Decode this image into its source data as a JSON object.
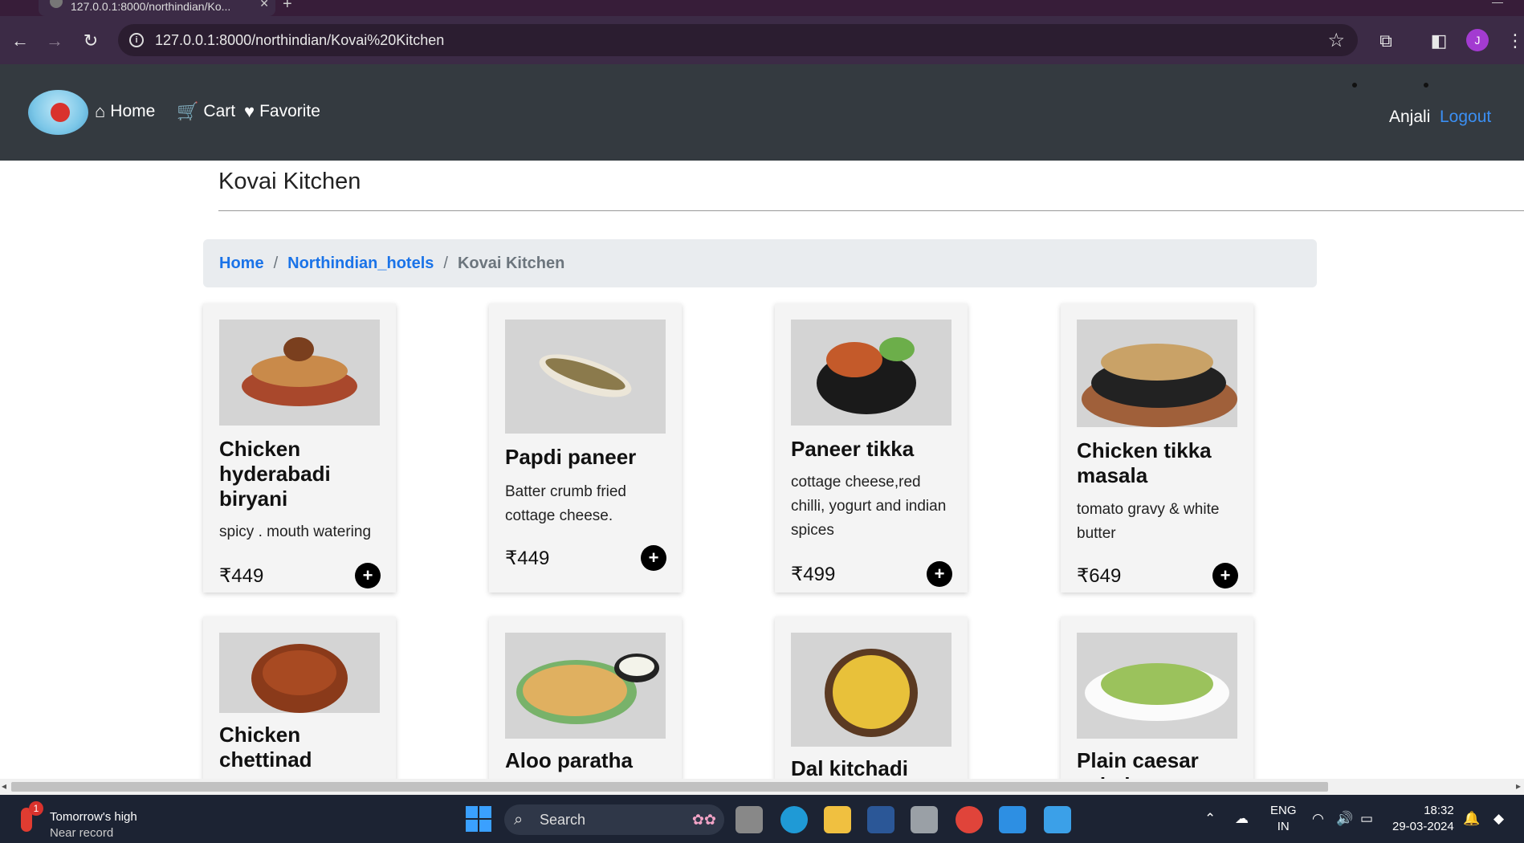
{
  "browser": {
    "tab_title": "127.0.0.1:8000/northindian/Ko...",
    "url": "127.0.0.1:8000/northindian/Kovai%20Kitchen",
    "profile_initial": "J"
  },
  "navbar": {
    "home": "Home",
    "cart": "Cart",
    "favorite": "Favorite",
    "user": "Anjali",
    "logout": "Logout"
  },
  "page": {
    "title": "Kovai Kitchen"
  },
  "breadcrumb": {
    "home": "Home",
    "section": "Northindian_hotels",
    "current": "Kovai Kitchen",
    "separator": "/"
  },
  "items": [
    {
      "name": "Chicken hyderabadi biryani",
      "desc": "spicy . mouth watering",
      "price": "₹449"
    },
    {
      "name": "Papdi paneer",
      "desc": "Batter crumb fried cottage cheese.",
      "price": "₹449"
    },
    {
      "name": "Paneer tikka",
      "desc": "cottage cheese,red chilli, yogurt and indian spices",
      "price": "₹499"
    },
    {
      "name": "Chicken tikka masala",
      "desc": "tomato gravy & white butter",
      "price": "₹649"
    },
    {
      "name": "Chicken chettinad",
      "desc": "",
      "price": ""
    },
    {
      "name": "Aloo paratha",
      "desc": "",
      "price": ""
    },
    {
      "name": "Dal kitchadi",
      "desc": "",
      "price": ""
    },
    {
      "name": "Plain caesar salad",
      "desc": "",
      "price": ""
    }
  ],
  "add_label": "+",
  "taskbar": {
    "weather_title": "Tomorrow's high",
    "weather_sub": "Near record",
    "weather_badge": "1",
    "search_placeholder": "Search",
    "lang_line1": "ENG",
    "lang_line2": "IN",
    "time": "18:32",
    "date": "29-03-2024"
  },
  "colors": {
    "navbar_bg": "#343a40",
    "link_blue": "#1a73e8",
    "logout_blue": "#3b8ff3",
    "card_bg": "#f4f4f4",
    "breadcrumb_bg": "#e9ecef"
  }
}
